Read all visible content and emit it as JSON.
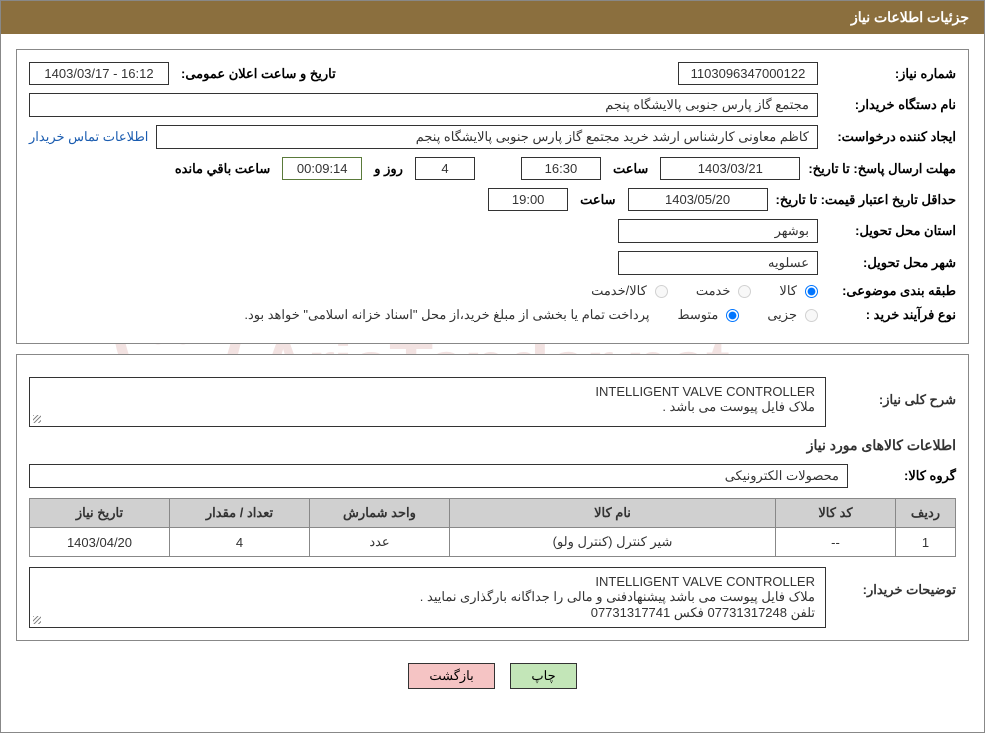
{
  "header": {
    "title": "جزئیات اطلاعات نیاز"
  },
  "fields": {
    "need_number_label": "شماره نیاز:",
    "need_number": "1103096347000122",
    "announce_label": "تاریخ و ساعت اعلان عمومی:",
    "announce_value": "16:12 - 1403/03/17",
    "buyer_org_label": "نام دستگاه خریدار:",
    "buyer_org": "مجتمع گاز پارس جنوبی  پالایشگاه پنجم",
    "requester_label": "ایجاد کننده درخواست:",
    "requester": "کاظم معاونی کارشناس ارشد خرید مجتمع گاز پارس جنوبی  پالایشگاه پنجم",
    "contact_link": "اطلاعات تماس خریدار",
    "deadline_label": "مهلت ارسال پاسخ:",
    "to_date_label": "تا تاریخ:",
    "min_validity_label": "حداقل تاریخ اعتبار قیمت:",
    "deadline_date": "1403/03/21",
    "hour_label": "ساعت",
    "deadline_time": "16:30",
    "days_label_suffix": "روز و",
    "days_remaining": "4",
    "countdown": "00:09:14",
    "remaining_label": "ساعت باقي مانده",
    "validity_date": "1403/05/20",
    "validity_time": "19:00",
    "province_label": "استان محل تحویل:",
    "province": "بوشهر",
    "city_label": "شهر محل تحویل:",
    "city": "عسلویه",
    "category_label": "طبقه بندی موضوعی:",
    "cat_goods": "کالا",
    "cat_service": "خدمت",
    "cat_goods_service": "کالا/خدمت",
    "purchase_type_label": "نوع فرآیند خرید :",
    "pt_partial": "جزیی",
    "pt_medium": "متوسط",
    "purchase_note": "پرداخت تمام یا بخشی از مبلغ خرید،از محل \"اسناد خزانه اسلامی\" خواهد بود.",
    "overview_label": "شرح کلی نیاز:",
    "overview_line1": "INTELLIGENT VALVE CONTROLLER",
    "overview_line2": "ملاک فایل پیوست می باشد .",
    "goods_section_title": "اطلاعات کالاهای مورد نیاز",
    "group_label": "گروه کالا:",
    "group_value": "محصولات الکترونیکی",
    "buyer_desc_label": "توضیحات خریدار:",
    "buyer_desc_line1": "INTELLIGENT VALVE CONTROLLER",
    "buyer_desc_line2": "ملاک فایل پیوست می باشد پیشنهادفنی و مالی را جداگانه بارگذاری نمایید .",
    "buyer_desc_line3": "تلفن 07731317248  فکس 07731317741"
  },
  "table": {
    "headers": {
      "row": "ردیف",
      "code": "کد کالا",
      "name": "نام کالا",
      "unit": "واحد شمارش",
      "qty": "تعداد / مقدار",
      "date": "تاریخ نیاز"
    },
    "rows": [
      {
        "row": "1",
        "code": "--",
        "name": "شیر کنترل (کنترل ولو)",
        "unit": "عدد",
        "qty": "4",
        "date": "1403/04/20"
      }
    ]
  },
  "buttons": {
    "print": "چاپ",
    "back": "بازگشت"
  },
  "watermark": {
    "text": "AriaTender.net"
  }
}
